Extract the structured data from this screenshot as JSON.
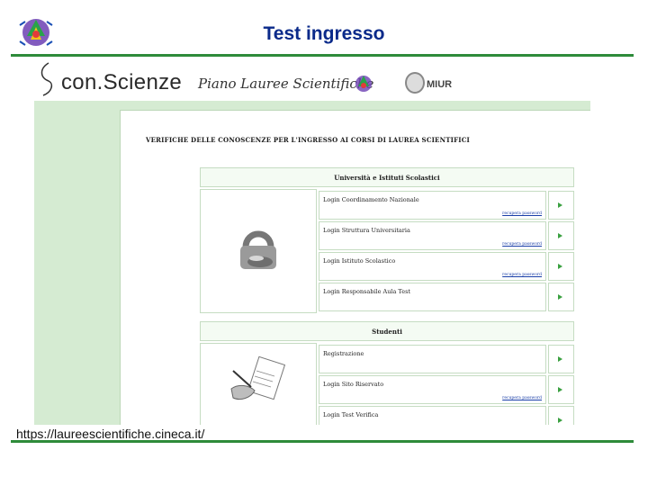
{
  "slide": {
    "title": "Test ingresso",
    "url": "https://laureescientifiche.cineca.it/"
  },
  "header": {
    "brand": "con.Scienze",
    "program": "Piano Lauree Scientifiche",
    "ministry": "MIUR"
  },
  "main": {
    "heading": "VERIFICHE DELLE CONOSCENZE PER L'INGRESSO AI CORSI DI LAUREA SCIENTIFICI",
    "sections": [
      {
        "title": "Università e Istituti Scolastici",
        "rows": [
          {
            "label": "Login Coordinamento Nazionale",
            "link": "recupera password"
          },
          {
            "label": "Login Struttura Universitaria",
            "link": "recupera password"
          },
          {
            "label": "Login Istituto Scolastico",
            "link": "recupera password"
          },
          {
            "label": "Login Responsabile Aula Test",
            "link": ""
          }
        ]
      },
      {
        "title": "Studenti",
        "rows": [
          {
            "label": "Registrazione",
            "link": ""
          },
          {
            "label": "Login Sito Riservato",
            "link": "recupera password"
          },
          {
            "label": "Login Test Verifica",
            "link": ""
          }
        ]
      }
    ]
  },
  "colors": {
    "title": "#0a2a8a",
    "rule": "#2e8b3a",
    "rail": "#d5ebd2",
    "arrow": "#3aa040"
  }
}
